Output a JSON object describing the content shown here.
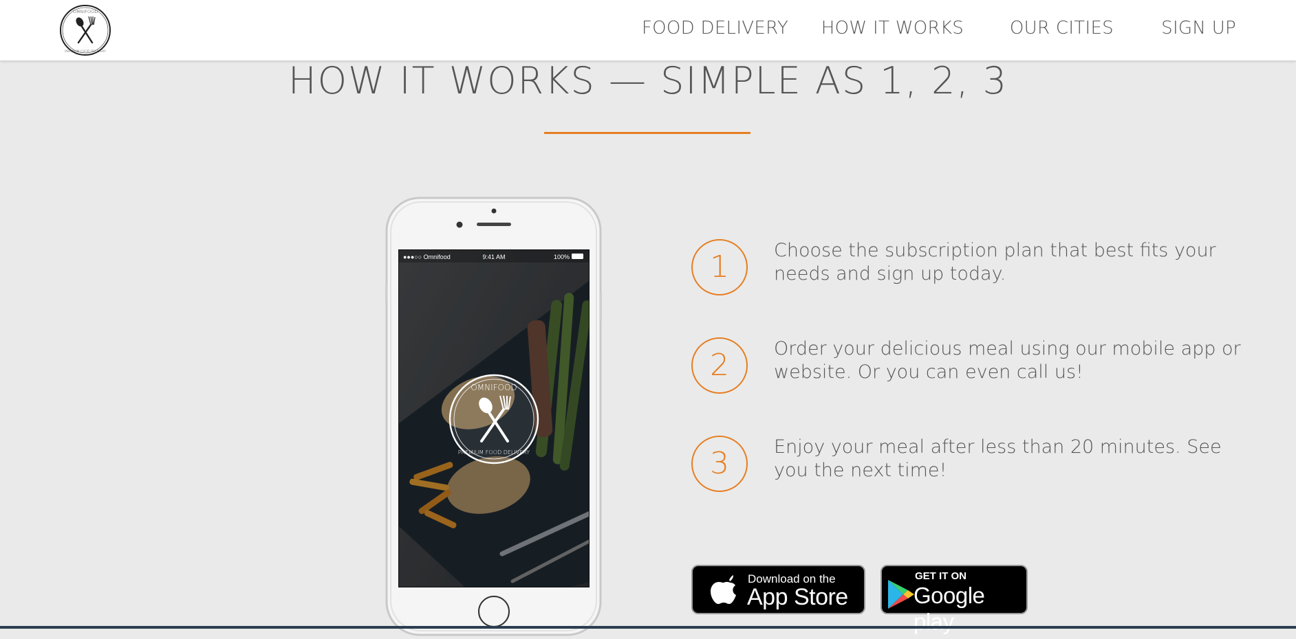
{
  "brand": {
    "logo_name": "OMNIFOOD",
    "logo_tagline": "PREMIUM FOOD DELIVERY",
    "logo_est": "EST 1988"
  },
  "nav": {
    "items": [
      {
        "label": "FOOD DELIVERY"
      },
      {
        "label": "HOW IT WORKS"
      },
      {
        "label": "OUR CITIES"
      },
      {
        "label": "SIGN UP"
      }
    ]
  },
  "section": {
    "title": "HOW IT WORKS — SIMPLE AS 1, 2, 3"
  },
  "phone": {
    "status_carrier": "●●●○○ Omnifood",
    "status_time": "9:41 AM",
    "status_battery": "100%"
  },
  "steps": [
    {
      "number": "1",
      "text": "Choose the subscription plan that best fits your needs and sign up today."
    },
    {
      "number": "2",
      "text": "Order your delicious meal using our mobile app or website. Or you can even call us!"
    },
    {
      "number": "3",
      "text": "Enjoy your meal after less than 20 minutes. See you the next time!"
    }
  ],
  "stores": {
    "appstore_small": "Download on the",
    "appstore_big": "App Store",
    "google_small": "GET IT ON",
    "google_big": "Google play"
  },
  "colors": {
    "accent": "#e67e22",
    "background": "#eaeaea",
    "text": "#555555",
    "header_bg": "#ffffff"
  }
}
